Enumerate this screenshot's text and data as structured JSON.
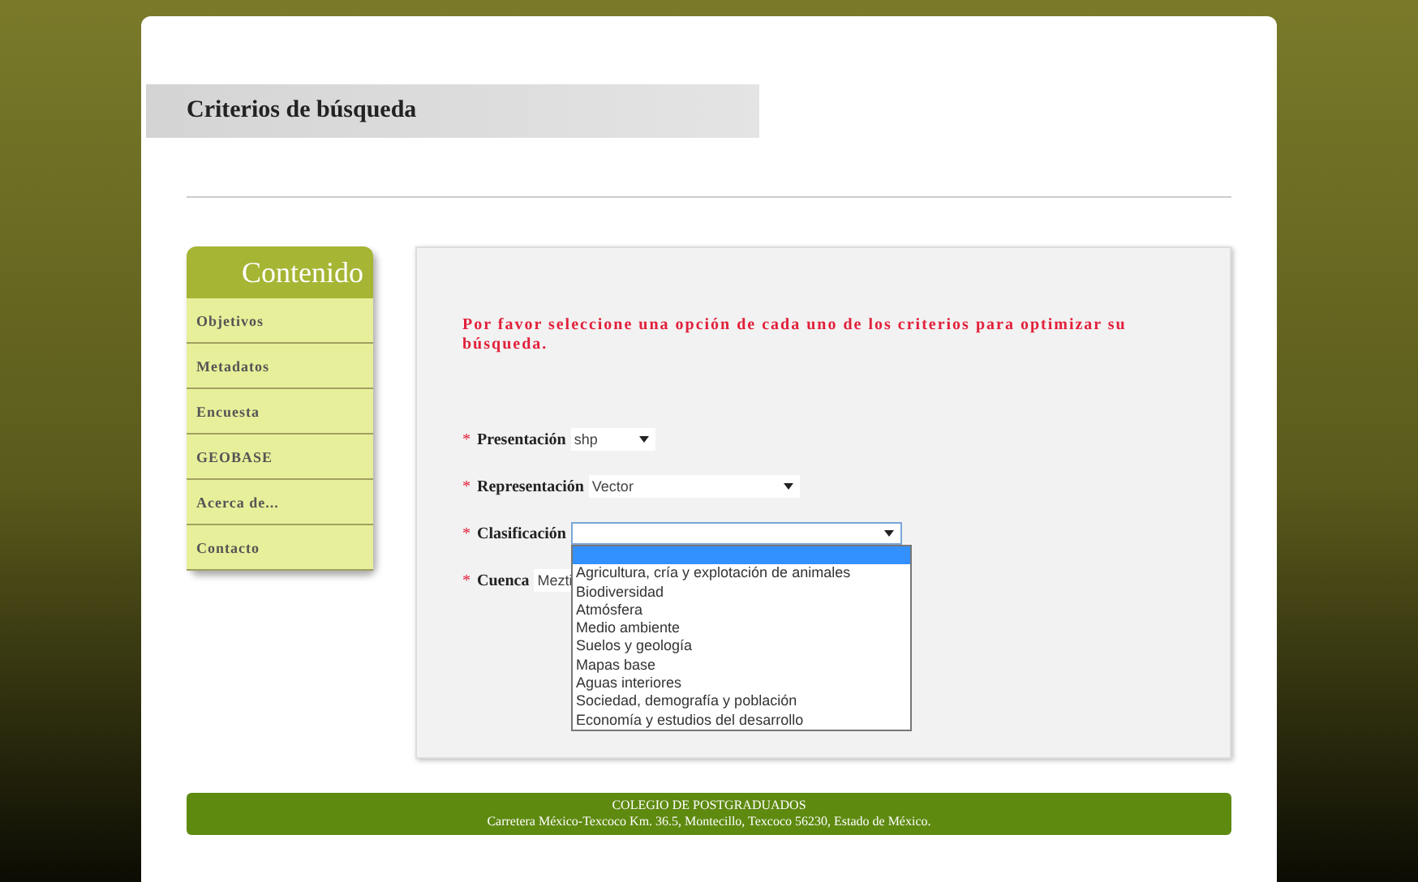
{
  "page_title": "Criterios de búsqueda",
  "sidebar": {
    "title": "Contenido",
    "items": [
      {
        "label": "Objetivos"
      },
      {
        "label": "Metadatos"
      },
      {
        "label": "Encuesta"
      },
      {
        "label": "GEOBASE"
      },
      {
        "label": "Acerca de..."
      },
      {
        "label": "Contacto"
      }
    ]
  },
  "notice": "Por favor seleccione una opción de cada uno de los criterios para optimizar su búsqueda.",
  "fields": [
    {
      "required": "*",
      "label": "Presentación",
      "value": "shp",
      "expanded": false
    },
    {
      "required": "*",
      "label": "Representación",
      "value": "Vector",
      "expanded": false
    },
    {
      "required": "*",
      "label": "Clasificación",
      "expanded": true,
      "options": [
        {
          "selected": true
        },
        {
          "label": "Agricultura, cría y explotación de animales",
          "selected": false
        },
        {
          "label": "Biodiversidad",
          "selected": false
        },
        {
          "label": "Atmósfera",
          "selected": false
        },
        {
          "label": "Medio ambiente",
          "selected": false
        },
        {
          "label": "Suelos y geología",
          "selected": false
        },
        {
          "label": "Mapas base",
          "selected": false
        },
        {
          "label": "Aguas interiores",
          "selected": false
        },
        {
          "label": "Sociedad, demografía y población",
          "selected": false
        },
        {
          "label": "Economía y estudios del desarrollo",
          "selected": false
        }
      ]
    },
    {
      "required": "*",
      "label": "Cuenca",
      "value": "Mezti",
      "expanded": false
    }
  ],
  "footer": {
    "title": "COLEGIO DE POSTGRADUADOS",
    "address": "Carretera México-Texcoco Km. 36.5, Montecillo, Texcoco 56230, Estado de México."
  }
}
